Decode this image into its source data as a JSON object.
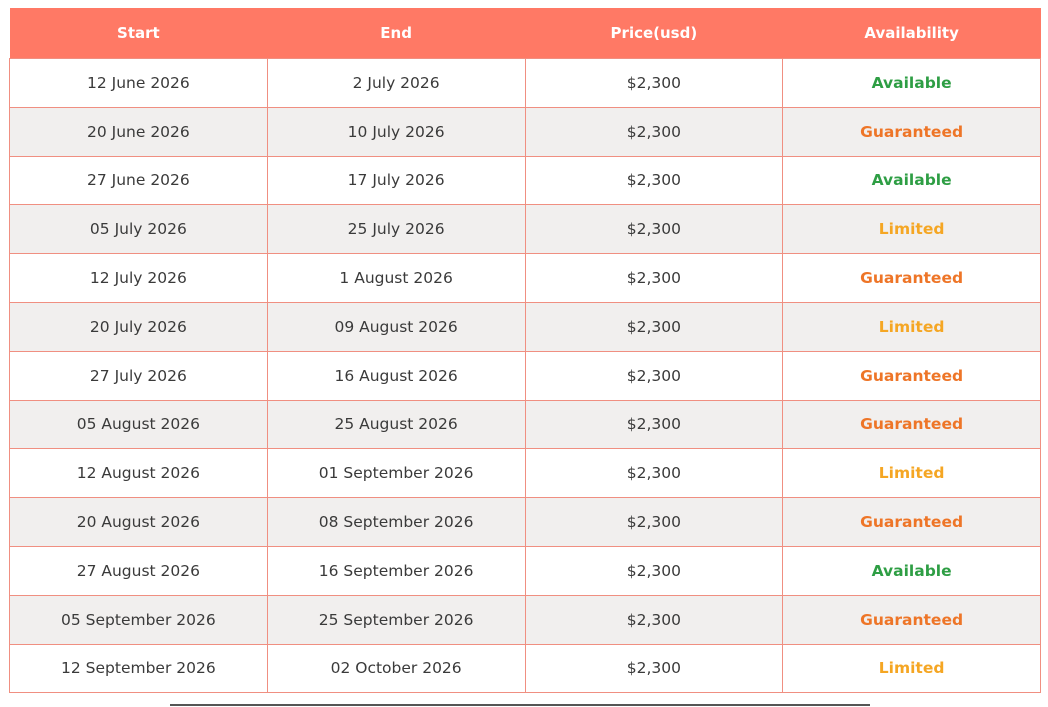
{
  "table": {
    "headers": [
      "Start",
      "End",
      "Price(usd)",
      "Availability"
    ],
    "rows": [
      {
        "start": "12 June 2026",
        "end": "2 July 2026",
        "price": "$2,300",
        "availability": "Available"
      },
      {
        "start": "20 June 2026",
        "end": "10 July 2026",
        "price": "$2,300",
        "availability": "Guaranteed"
      },
      {
        "start": "27 June 2026",
        "end": "17 July 2026",
        "price": "$2,300",
        "availability": "Available"
      },
      {
        "start": "05 July 2026",
        "end": "25 July 2026",
        "price": "$2,300",
        "availability": "Limited"
      },
      {
        "start": "12 July 2026",
        "end": "1 August 2026",
        "price": "$2,300",
        "availability": "Guaranteed"
      },
      {
        "start": "20 July 2026",
        "end": "09 August 2026",
        "price": "$2,300",
        "availability": "Limited"
      },
      {
        "start": "27 July 2026",
        "end": "16 August 2026",
        "price": "$2,300",
        "availability": "Guaranteed"
      },
      {
        "start": "05 August 2026",
        "end": "25 August 2026",
        "price": "$2,300",
        "availability": "Guaranteed"
      },
      {
        "start": "12 August 2026",
        "end": "01 September 2026",
        "price": "$2,300",
        "availability": "Limited"
      },
      {
        "start": "20 August 2026",
        "end": "08 September 2026",
        "price": "$2,300",
        "availability": "Guaranteed"
      },
      {
        "start": "27 August 2026",
        "end": "16 September 2026",
        "price": "$2,300",
        "availability": "Available"
      },
      {
        "start": "05 September 2026",
        "end": "25 September 2026",
        "price": "$2,300",
        "availability": "Guaranteed"
      },
      {
        "start": "12 September 2026",
        "end": "02 October 2026",
        "price": "$2,300",
        "availability": "Limited"
      }
    ]
  },
  "colors": {
    "header_bg": "#ff7965",
    "header_text": "#ffffff",
    "border": "#f08f81",
    "row_alt_bg": "#f1efee",
    "available": "#2e9e44",
    "guaranteed": "#ee7527",
    "limited": "#f5a623"
  }
}
